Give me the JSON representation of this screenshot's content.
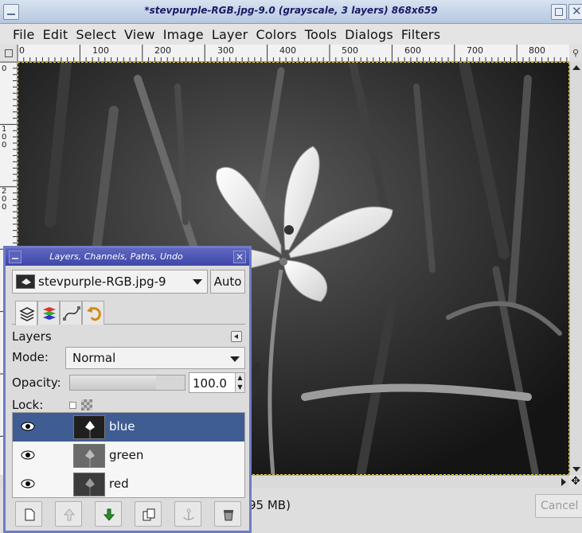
{
  "window": {
    "title": "*stevpurple-RGB.jpg-9.0 (grayscale, 3 layers) 868x659"
  },
  "menu": [
    "File",
    "Edit",
    "Select",
    "View",
    "Image",
    "Layer",
    "Colors",
    "Tools",
    "Dialogs",
    "Filters"
  ],
  "rulers": {
    "horizontal": [
      "0",
      "100",
      "200",
      "300",
      "400",
      "500",
      "600",
      "700",
      "800"
    ],
    "vertical": [
      "0",
      "100",
      "200"
    ]
  },
  "status": {
    "text": "95 MB)",
    "cancel_label": "Cancel"
  },
  "dock": {
    "title": "Layers, Channels, Paths, Undo",
    "image_name": "stevpurple-RGB.jpg-9",
    "auto_label": "Auto",
    "panel_label": "Layers",
    "mode_label": "Mode:",
    "mode_value": "Normal",
    "opacity_label": "Opacity:",
    "opacity_value": "100.0",
    "lock_label": "Lock:",
    "layers": [
      {
        "name": "blue",
        "selected": true
      },
      {
        "name": "green",
        "selected": false
      },
      {
        "name": "red",
        "selected": false
      }
    ],
    "tab_icons": [
      "layers-tab-icon",
      "channels-tab-icon",
      "paths-tab-icon",
      "undo-tab-icon"
    ],
    "button_icons": [
      "new-layer-icon",
      "raise-layer-icon",
      "lower-layer-icon",
      "duplicate-layer-icon",
      "anchor-layer-icon",
      "delete-layer-icon"
    ]
  },
  "colors": {
    "dock_border": "#6f7bc7",
    "dock_title": "#4a52b5",
    "selected_row": "#3f5d93",
    "selection_marquee": "#d8c24a"
  }
}
